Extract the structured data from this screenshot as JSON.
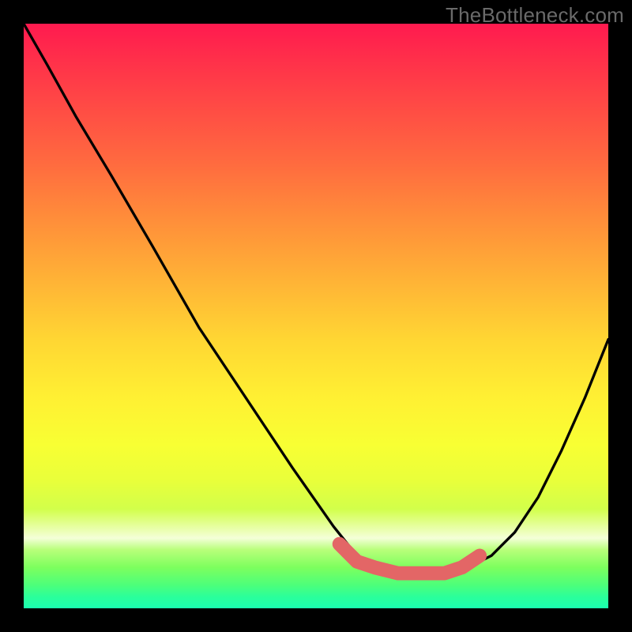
{
  "watermark": "TheBottleneck.com",
  "chart_data": {
    "type": "line",
    "title": "",
    "xlabel": "",
    "ylabel": "",
    "xlim": [
      0,
      100
    ],
    "ylim": [
      0,
      100
    ],
    "background_gradient": {
      "orientation": "vertical",
      "stops": [
        {
          "pct": 0,
          "color": "#ff1a4f"
        },
        {
          "pct": 14,
          "color": "#ff4a45"
        },
        {
          "pct": 33,
          "color": "#ff8c3a"
        },
        {
          "pct": 54,
          "color": "#ffd633"
        },
        {
          "pct": 72,
          "color": "#f8ff33"
        },
        {
          "pct": 88,
          "color": "#f4ffd8"
        },
        {
          "pct": 96,
          "color": "#4dff7a"
        },
        {
          "pct": 100,
          "color": "#1affb0"
        }
      ]
    },
    "series": [
      {
        "name": "black-curve",
        "color": "#000000",
        "x": [
          0,
          4,
          9,
          15,
          22,
          30,
          38,
          46,
          53,
          57,
          60,
          64,
          70,
          76,
          80,
          84,
          88,
          92,
          96,
          100
        ],
        "y": [
          100,
          93,
          84,
          74,
          62,
          48,
          36,
          24,
          14,
          9,
          7,
          6,
          6,
          7,
          9,
          13,
          19,
          27,
          36,
          46
        ]
      },
      {
        "name": "red-band",
        "color": "#e36666",
        "style": "thick",
        "x": [
          54,
          57,
          60,
          64,
          68,
          72,
          75,
          78
        ],
        "y": [
          11,
          8,
          7,
          6,
          6,
          6,
          7,
          9
        ]
      }
    ]
  }
}
